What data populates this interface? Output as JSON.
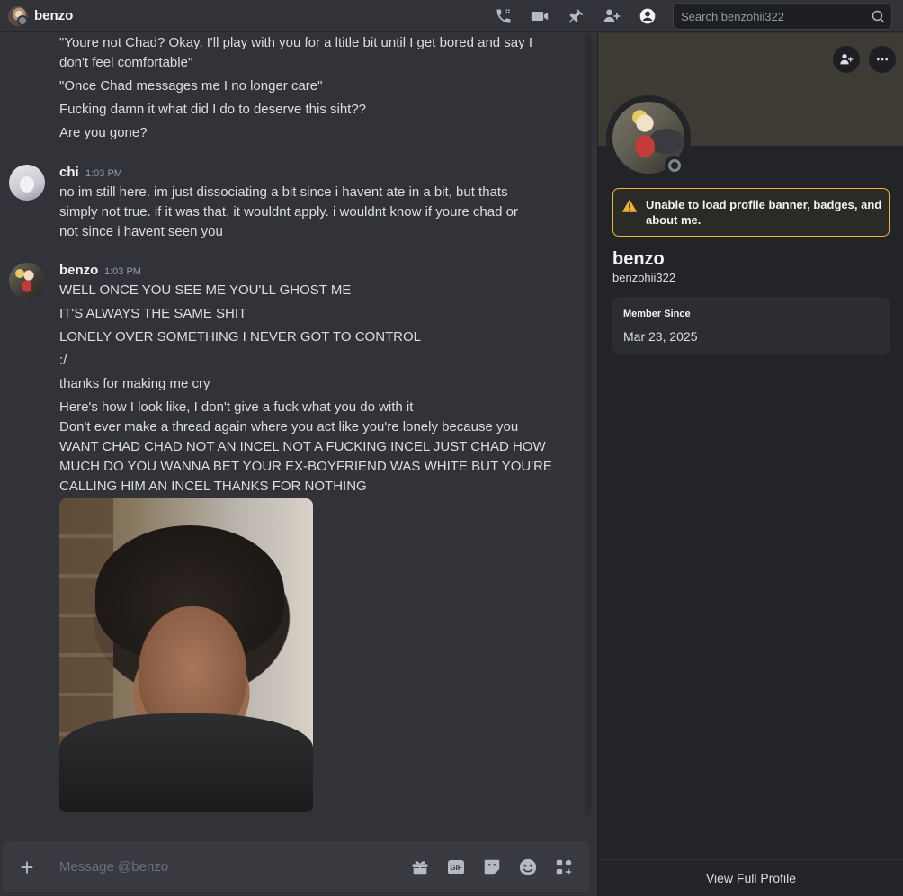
{
  "header": {
    "title": "benzo",
    "search_placeholder": "Search benzohii322",
    "icons": [
      "phone-call-icon",
      "video-call-icon",
      "pin-icon",
      "add-friend-icon",
      "user-profile-icon",
      "search-icon"
    ]
  },
  "chat": {
    "continued_lines": [
      "\"Youre not Chad? Okay, I'll play with you for a ltitle bit until I get bored and say I",
      "don't feel comfortable\"",
      "\"Once Chad messages me I no longer care\"",
      "Fucking damn it what did I do to deserve this siht??",
      "Are you gone?"
    ],
    "messages": [
      {
        "author": "chi",
        "time": "1:03 PM",
        "lines": [
          "no im still here. im just dissociating a bit since i havent ate in a bit, but thats",
          "simply not true. if it was that, it wouldnt apply. i wouldnt know if youre chad or",
          "not since i havent seen you"
        ]
      },
      {
        "author": "benzo",
        "time": "1:03 PM",
        "lines": [
          "WELL ONCE YOU SEE ME YOU'LL GHOST ME",
          "IT'S ALWAYS THE SAME SHIT",
          "LONELY OVER SOMETHING I NEVER GOT TO CONTROL",
          ":/",
          "thanks for making me cry",
          "Here's how I look like, I don't give a fuck what you do with it",
          "Don't ever make a thread again where you act like you're lonely because you",
          "WANT CHAD CHAD NOT AN INCEL NOT A FUCKING INCEL JUST CHAD HOW",
          "MUCH DO YOU WANNA BET YOUR EX-BOYFRIEND WAS WHITE BUT YOU'RE",
          "CALLING HIM AN INCEL THANKS FOR NOTHING"
        ]
      }
    ]
  },
  "composer": {
    "placeholder": "Message @benzo",
    "gif_label": "GIF",
    "icons": [
      "add-attachment-icon",
      "gift-icon",
      "gif-icon",
      "sticker-icon",
      "emoji-icon",
      "apps-icon"
    ]
  },
  "profile": {
    "warning": "Unable to load profile banner, badges, and about me.",
    "display_name": "benzo",
    "username": "benzohii322",
    "member_since_label": "Member Since",
    "member_since_date": "Mar 23, 2025",
    "footer_link": "View Full Profile"
  },
  "colors": {
    "background": "#323339",
    "profile_background": "#232428",
    "banner": "#3e3b34",
    "warning_border": "#f0b232"
  }
}
